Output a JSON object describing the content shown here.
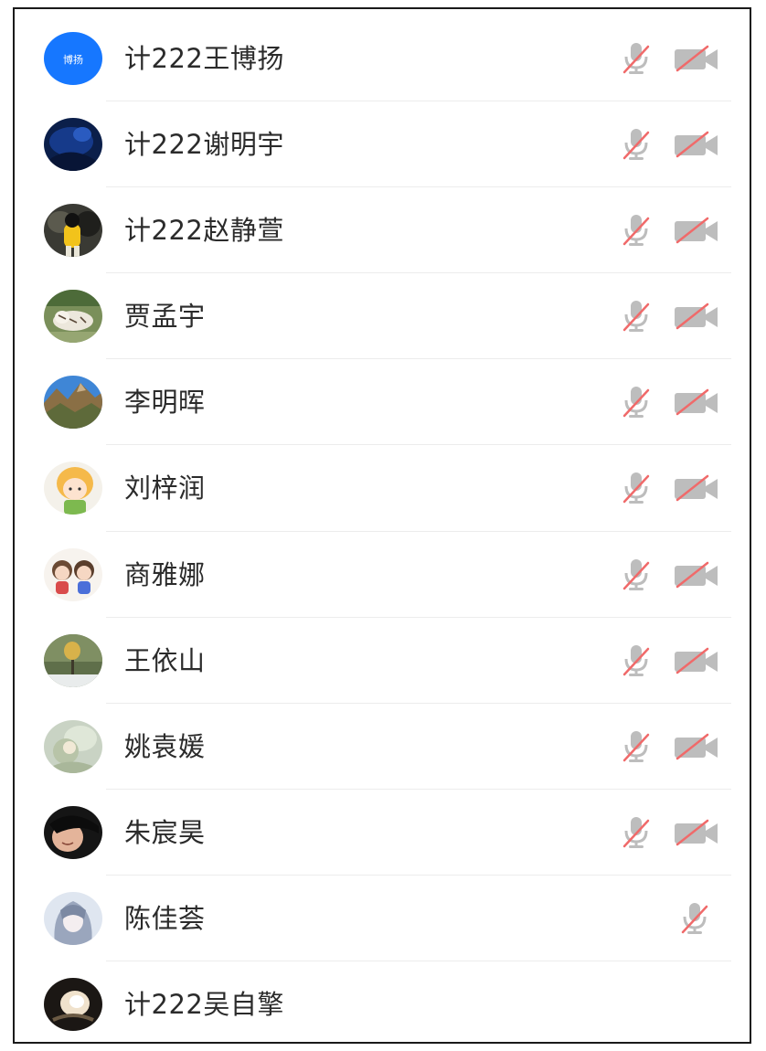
{
  "participants": [
    {
      "name": "计222王博扬",
      "avatar_text": "博扬",
      "avatar": "blue-initials",
      "mic": "muted",
      "camera": "off"
    },
    {
      "name": "计222谢明宇",
      "avatar": "dark-blue-photo",
      "mic": "muted",
      "camera": "off"
    },
    {
      "name": "计222赵静萱",
      "avatar": "yellow-character-photo",
      "mic": "muted",
      "camera": "off"
    },
    {
      "name": "贾孟宇",
      "avatar": "tiger-photo",
      "mic": "muted",
      "camera": "off"
    },
    {
      "name": "李明晖",
      "avatar": "mountain-photo",
      "mic": "muted",
      "camera": "off"
    },
    {
      "name": "刘梓润",
      "avatar": "anime-girl-photo",
      "mic": "muted",
      "camera": "off"
    },
    {
      "name": "商雅娜",
      "avatar": "cartoon-pair-photo",
      "mic": "muted",
      "camera": "off"
    },
    {
      "name": "王依山",
      "avatar": "tree-landscape-photo",
      "mic": "muted",
      "camera": "off"
    },
    {
      "name": "姚袁媛",
      "avatar": "soft-illustration-photo",
      "mic": "muted",
      "camera": "off"
    },
    {
      "name": "朱宸昊",
      "avatar": "portrait-photo",
      "mic": "muted",
      "camera": "off"
    },
    {
      "name": "陈佳荟",
      "avatar": "anime-character-photo",
      "mic": "muted",
      "camera": "none"
    },
    {
      "name": "计222吴自擎",
      "avatar": "light-burst-photo",
      "mic": "none",
      "camera": "none"
    }
  ],
  "colors": {
    "accent_blue": "#1677ff",
    "icon_gray": "#bdbdbd",
    "slash_red": "#f06a6a",
    "divider": "#ececec",
    "text": "#2b2b2b"
  },
  "icons": {
    "mic_muted": "microphone-muted-icon",
    "camera_off": "camera-off-icon"
  }
}
